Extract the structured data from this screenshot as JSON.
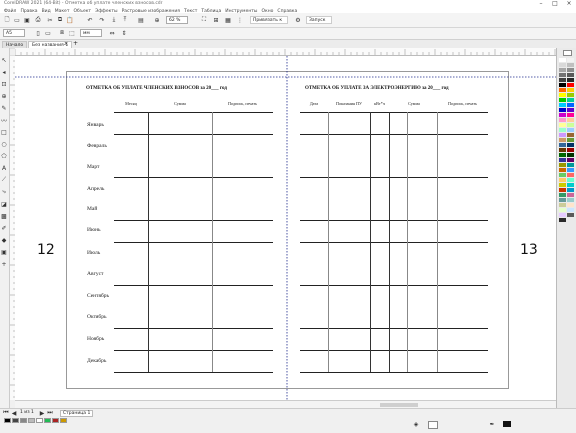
{
  "window": {
    "title": "CorelDRAW 2021 (64-Bit) - Отметка об уплате членских взносов.cdr"
  },
  "menu": [
    "Файл",
    "Правка",
    "Вид",
    "Макет",
    "Объект",
    "Эффекты",
    "Растровые изображения",
    "Текст",
    "Таблица",
    "Инструменты",
    "Окно",
    "Справка"
  ],
  "toolbar": {
    "zoom": "62 %",
    "snap_label": "Привязать к",
    "launch_label": "Запуск"
  },
  "propbar": {
    "paper": "A5",
    "unit": "мм"
  },
  "tabs": [
    {
      "label": "Начало"
    },
    {
      "label": "Без названия-1",
      "active": true
    }
  ],
  "left_page": {
    "number": "12",
    "title": "ОТМЕТКА ОБ УПЛАТЕ ЧЛЕНСКИХ ВЗНОСОВ за 20___ год",
    "headers": [
      "Месяц",
      "Сумма",
      "Подпись, печать"
    ],
    "months": [
      "Январь",
      "Февраль",
      "Март",
      "Апрель",
      "Май",
      "Июнь",
      "Июль",
      "Август",
      "Сентябрь",
      "Октябрь",
      "Ноябрь",
      "Декабрь"
    ]
  },
  "right_page": {
    "number": "13",
    "title": "ОТМЕТКА ОБ УПЛАТЕ ЗА ЭЛЕКТРОЭНЕРГИЮ за 20___ год",
    "headers": [
      "Дата",
      "Показания ПУ",
      "кВт*ч",
      "Сумма",
      "Подпись, печать"
    ]
  },
  "statusbar": {
    "page_info": "1 из 1",
    "page_tab": "Страница 1"
  },
  "colors": {
    "guides": "#1e2a8c",
    "page_border": "#999999"
  }
}
